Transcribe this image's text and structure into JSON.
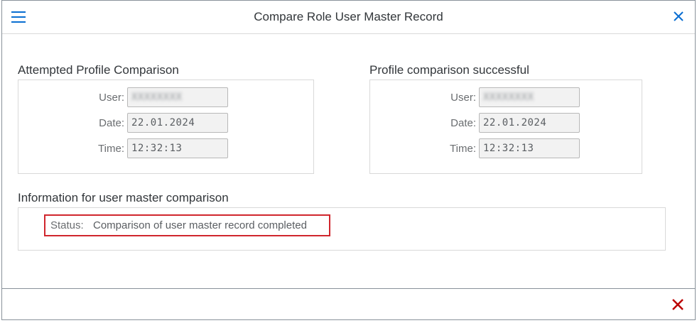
{
  "dialog": {
    "title": "Compare Role User Master Record",
    "menu_icon": "hamburger-menu-icon",
    "close_icon": "close-icon",
    "accent_color": "#0a6ed1"
  },
  "attempted": {
    "heading": "Attempted Profile Comparison",
    "user_label": "User:",
    "user_value": "XXXXXXXX",
    "date_label": "Date:",
    "date_value": "22.01.2024",
    "time_label": "Time:",
    "time_value": "12:32:13"
  },
  "successful": {
    "heading": "Profile comparison successful",
    "user_label": "User:",
    "user_value": "XXXXXXXX",
    "date_label": "Date:",
    "date_value": "22.01.2024",
    "time_label": "Time:",
    "time_value": "12:32:13"
  },
  "info": {
    "heading": "Information for user master comparison",
    "status_label": "Status:",
    "status_value": "Comparison of user master record completed",
    "highlight_color": "#d0262d"
  },
  "footer": {
    "cancel_icon": "cancel-icon",
    "cancel_color": "#bb0000"
  }
}
